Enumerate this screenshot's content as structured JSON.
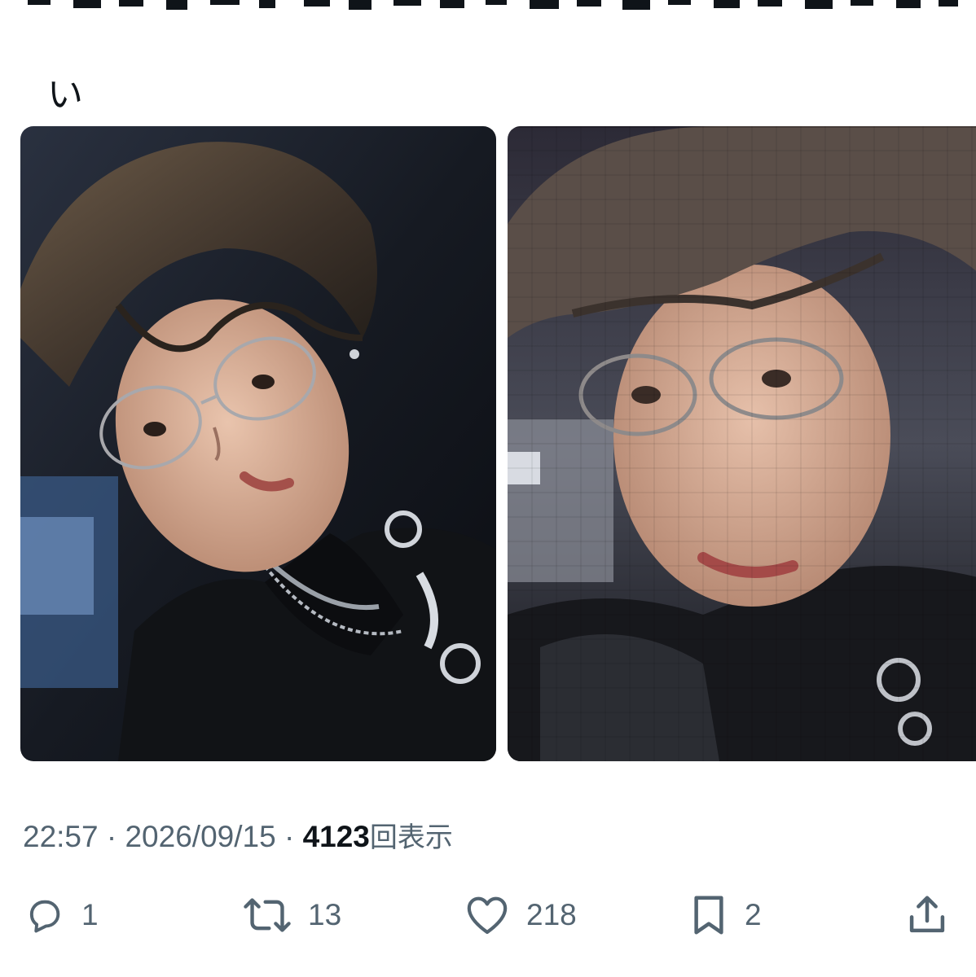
{
  "tweet": {
    "text_tail": "い"
  },
  "media": [
    {
      "icon": "photo-portrait-clear"
    },
    {
      "icon": "photo-portrait-pixelated"
    }
  ],
  "meta": {
    "time": "22:57",
    "separator": "·",
    "date": "2026/09/15",
    "views_count": "4123",
    "views_label": "回表示"
  },
  "actions": {
    "reply": {
      "icon": "reply-icon",
      "count": "1"
    },
    "repost": {
      "icon": "repost-icon",
      "count": "13"
    },
    "like": {
      "icon": "heart-icon",
      "count": "218"
    },
    "bookmark": {
      "icon": "bookmark-icon",
      "count": "2"
    },
    "share": {
      "icon": "share-icon"
    }
  },
  "colors": {
    "text": "#0f1419",
    "secondary": "#536471",
    "background": "#ffffff"
  }
}
